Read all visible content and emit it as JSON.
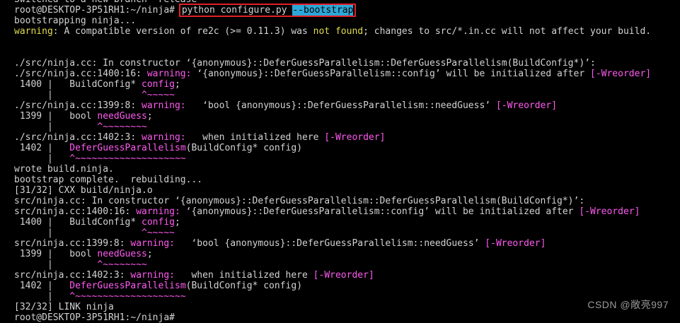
{
  "terminal": {
    "lines": [
      {
        "segments": [
          {
            "t": "Switched to a new branch 'release'",
            "c": ""
          }
        ]
      },
      {
        "segments": [
          {
            "t": "root@DESKTOP-3P51RH1:~/ninja# ",
            "c": ""
          },
          {
            "t": "python configure.py ",
            "c": "cmd"
          },
          {
            "t": "--bootstrap",
            "c": "cmdhl"
          }
        ]
      },
      {
        "segments": [
          {
            "t": "bootstrapping ninja...",
            "c": ""
          }
        ]
      },
      {
        "segments": [
          {
            "t": "warning",
            "c": "yellow"
          },
          {
            "t": ": A compatible version of re2c (>= 0.11.3) was ",
            "c": ""
          },
          {
            "t": "not found",
            "c": "yellow"
          },
          {
            "t": "; changes to src/*.in.cc will not affect your build.",
            "c": ""
          }
        ]
      },
      {
        "segments": [
          {
            "t": "",
            "c": ""
          }
        ]
      },
      {
        "segments": [
          {
            "t": "",
            "c": ""
          }
        ]
      },
      {
        "segments": [
          {
            "t": "./src/ninja.cc: In constructor ‘{anonymous}::DeferGuessParallelism::DeferGuessParallelism(BuildConfig*)’:",
            "c": ""
          }
        ]
      },
      {
        "segments": [
          {
            "t": "./src/ninja.cc:1400:16: ",
            "c": ""
          },
          {
            "t": "warning:",
            "c": "pink"
          },
          {
            "t": " ‘{anonymous}::DeferGuessParallelism::config’ will be initialized after ",
            "c": ""
          },
          {
            "t": "[-Wreorder]",
            "c": "pink"
          }
        ]
      },
      {
        "segments": [
          {
            "t": " 1400 |   BuildConfig* ",
            "c": ""
          },
          {
            "t": "config",
            "c": "pink"
          },
          {
            "t": ";",
            "c": ""
          }
        ]
      },
      {
        "segments": [
          {
            "t": "      |                ",
            "c": ""
          },
          {
            "t": "^~~~~~",
            "c": "pink"
          }
        ]
      },
      {
        "segments": [
          {
            "t": "./src/ninja.cc:1399:8: ",
            "c": ""
          },
          {
            "t": "warning:",
            "c": "pink"
          },
          {
            "t": "   ‘bool {anonymous}::DeferGuessParallelism::needGuess’ ",
            "c": ""
          },
          {
            "t": "[-Wreorder]",
            "c": "pink"
          }
        ]
      },
      {
        "segments": [
          {
            "t": " 1399 |   bool ",
            "c": ""
          },
          {
            "t": "needGuess",
            "c": "pink"
          },
          {
            "t": ";",
            "c": ""
          }
        ]
      },
      {
        "segments": [
          {
            "t": "      |        ",
            "c": ""
          },
          {
            "t": "^~~~~~~~~",
            "c": "pink"
          }
        ]
      },
      {
        "segments": [
          {
            "t": "./src/ninja.cc:1402:3: ",
            "c": ""
          },
          {
            "t": "warning:",
            "c": "pink"
          },
          {
            "t": "   when initialized here ",
            "c": ""
          },
          {
            "t": "[-Wreorder]",
            "c": "pink"
          }
        ]
      },
      {
        "segments": [
          {
            "t": " 1402 |   ",
            "c": ""
          },
          {
            "t": "DeferGuessParallelism",
            "c": "pink"
          },
          {
            "t": "(BuildConfig* config)",
            "c": ""
          }
        ]
      },
      {
        "segments": [
          {
            "t": "      |   ",
            "c": ""
          },
          {
            "t": "^~~~~~~~~~~~~~~~~~~~~",
            "c": "pink"
          }
        ]
      },
      {
        "segments": [
          {
            "t": "wrote build.ninja.",
            "c": ""
          }
        ]
      },
      {
        "segments": [
          {
            "t": "bootstrap complete.  rebuilding...",
            "c": ""
          }
        ]
      },
      {
        "segments": [
          {
            "t": "[31/32] CXX build/ninja.o",
            "c": ""
          }
        ]
      },
      {
        "segments": [
          {
            "t": "src/ninja.cc: In constructor ‘{anonymous}::DeferGuessParallelism::DeferGuessParallelism(BuildConfig*)’:",
            "c": ""
          }
        ]
      },
      {
        "segments": [
          {
            "t": "src/ninja.cc:1400:16: ",
            "c": ""
          },
          {
            "t": "warning:",
            "c": "pink"
          },
          {
            "t": " ‘{anonymous}::DeferGuessParallelism::config’ will be initialized after ",
            "c": ""
          },
          {
            "t": "[-Wreorder]",
            "c": "pink"
          }
        ]
      },
      {
        "segments": [
          {
            "t": " 1400 |   BuildConfig* ",
            "c": ""
          },
          {
            "t": "config",
            "c": "pink"
          },
          {
            "t": ";",
            "c": ""
          }
        ]
      },
      {
        "segments": [
          {
            "t": "      |                ",
            "c": ""
          },
          {
            "t": "^~~~~~",
            "c": "pink"
          }
        ]
      },
      {
        "segments": [
          {
            "t": "src/ninja.cc:1399:8: ",
            "c": ""
          },
          {
            "t": "warning:",
            "c": "pink"
          },
          {
            "t": "   ‘bool {anonymous}::DeferGuessParallelism::needGuess’ ",
            "c": ""
          },
          {
            "t": "[-Wreorder]",
            "c": "pink"
          }
        ]
      },
      {
        "segments": [
          {
            "t": " 1399 |   bool ",
            "c": ""
          },
          {
            "t": "needGuess",
            "c": "pink"
          },
          {
            "t": ";",
            "c": ""
          }
        ]
      },
      {
        "segments": [
          {
            "t": "      |        ",
            "c": ""
          },
          {
            "t": "^~~~~~~~~",
            "c": "pink"
          }
        ]
      },
      {
        "segments": [
          {
            "t": "src/ninja.cc:1402:3: ",
            "c": ""
          },
          {
            "t": "warning:",
            "c": "pink"
          },
          {
            "t": "   when initialized here ",
            "c": ""
          },
          {
            "t": "[-Wreorder]",
            "c": "pink"
          }
        ]
      },
      {
        "segments": [
          {
            "t": " 1402 |   ",
            "c": ""
          },
          {
            "t": "DeferGuessParallelism",
            "c": "pink"
          },
          {
            "t": "(BuildConfig* config)",
            "c": ""
          }
        ]
      },
      {
        "segments": [
          {
            "t": "      |   ",
            "c": ""
          },
          {
            "t": "^~~~~~~~~~~~~~~~~~~~~",
            "c": "pink"
          }
        ]
      },
      {
        "segments": [
          {
            "t": "[32/32] LINK ninja",
            "c": ""
          }
        ]
      },
      {
        "segments": [
          {
            "t": "root@DESKTOP-3P51RH1:~/ninja#",
            "c": ""
          }
        ]
      }
    ]
  },
  "watermark": "CSDN @敞亮997",
  "colors": {
    "background": "#000000",
    "text": "#d3d3d3",
    "warning_yellow": "#e0dc4c",
    "warning_pink": "#ff5af1",
    "command_highlight": "#2ba8d8",
    "annotation_box": "#e0202a"
  }
}
